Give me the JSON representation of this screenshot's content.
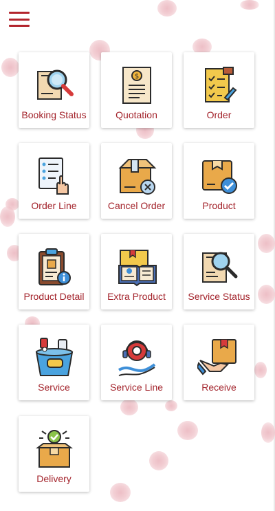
{
  "header": {
    "menu_icon": "hamburger-menu-icon",
    "menu_color": "#b3242c"
  },
  "colors": {
    "label": "#a3232b",
    "background": "#ffffff",
    "tile": "#ffffff"
  },
  "tiles": [
    {
      "label": "Booking Status",
      "icon": "magnifier-document-icon"
    },
    {
      "label": "Quotation",
      "icon": "invoice-dollar-icon"
    },
    {
      "label": "Order",
      "icon": "order-checklist-icon"
    },
    {
      "label": "Order Line",
      "icon": "list-touch-icon"
    },
    {
      "label": "Cancel Order",
      "icon": "box-cancel-icon"
    },
    {
      "label": "Product",
      "icon": "box-check-icon"
    },
    {
      "label": "Product Detail",
      "icon": "clipboard-info-icon"
    },
    {
      "label": "Extra Product",
      "icon": "book-info-icon"
    },
    {
      "label": "Service Status",
      "icon": "magnifier-report-icon"
    },
    {
      "label": "Service",
      "icon": "cleaning-bucket-icon"
    },
    {
      "label": "Service Line",
      "icon": "support-gear-icon"
    },
    {
      "label": "Receive",
      "icon": "hand-box-icon"
    },
    {
      "label": "Delivery",
      "icon": "open-box-check-icon"
    }
  ]
}
